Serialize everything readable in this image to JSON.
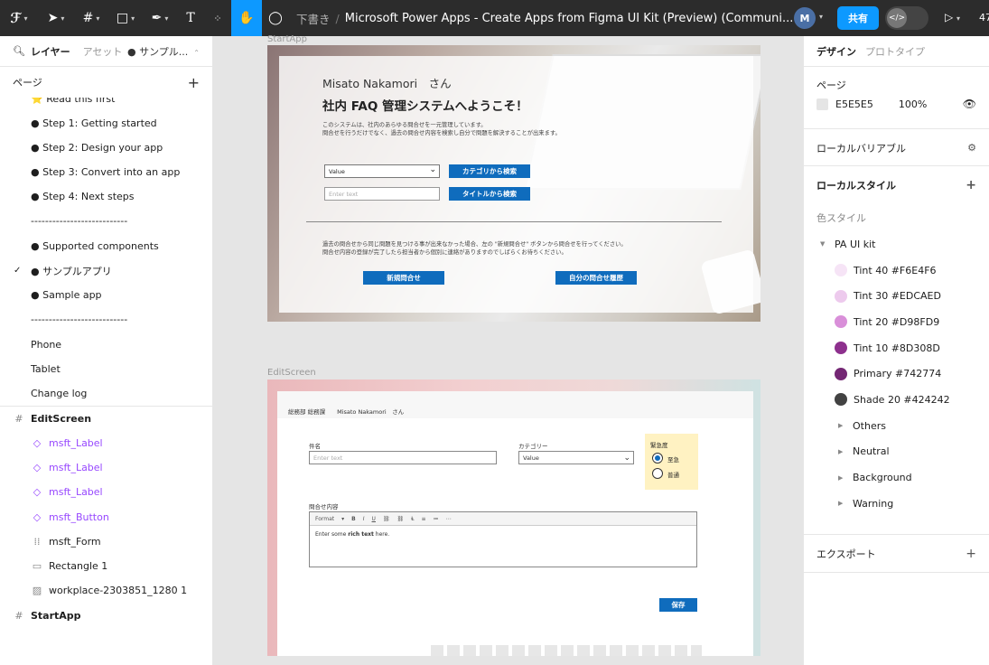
{
  "toolbar": {
    "breadcrumb_draft": "下書き",
    "breadcrumb_sep": "/",
    "file_title": "Microsoft Power Apps - Create Apps from Figma UI Kit (Preview) (Communi...",
    "avatar_initial": "M",
    "share_label": "共有",
    "dev_mode_label": "</>",
    "zoom_partial": "47"
  },
  "left_panel": {
    "tab_layers": "レイヤー",
    "tab_assets": "アセット",
    "current_page": "● サンプル...",
    "pages_header": "ページ",
    "pages": [
      {
        "label": "⭐ Read this first",
        "checked": false
      },
      {
        "label": "● Step 1: Getting started",
        "checked": false
      },
      {
        "label": "● Step 2: Design your app",
        "checked": false
      },
      {
        "label": "● Step 3: Convert into an app",
        "checked": false
      },
      {
        "label": "● Step 4: Next steps",
        "checked": false
      },
      {
        "label": "---------------------------",
        "checked": false
      },
      {
        "label": "● Supported components",
        "checked": false
      },
      {
        "label": "● サンプルアプリ",
        "checked": true
      },
      {
        "label": "● Sample app",
        "checked": false
      },
      {
        "label": "---------------------------",
        "checked": false
      },
      {
        "label": "Phone",
        "checked": false
      },
      {
        "label": "Tablet",
        "checked": false
      },
      {
        "label": "Change log",
        "checked": false
      }
    ],
    "layers": [
      {
        "label": "EditScreen",
        "kind": "frame",
        "icon": "#"
      },
      {
        "label": "msft_Label",
        "kind": "comp",
        "icon": "◇"
      },
      {
        "label": "msft_Label",
        "kind": "comp",
        "icon": "◇"
      },
      {
        "label": "msft_Label",
        "kind": "comp",
        "icon": "◇"
      },
      {
        "label": "msft_Button",
        "kind": "comp",
        "icon": "◇"
      },
      {
        "label": "msft_Form",
        "kind": "normal",
        "icon": "⁞⁞"
      },
      {
        "label": "Rectangle 1",
        "kind": "normal",
        "icon": "▭"
      },
      {
        "label": "workplace-2303851_1280 1",
        "kind": "normal",
        "icon": "▨"
      },
      {
        "label": "StartApp",
        "kind": "frame",
        "icon": "#"
      }
    ]
  },
  "right_panel": {
    "tab_design": "デザイン",
    "tab_prototype": "プロトタイプ",
    "page_section": "ページ",
    "page_color_hex": "E5E5E5",
    "page_color": "#e5e5e5",
    "page_opacity": "100%",
    "local_variables": "ローカルバリアブル",
    "local_styles": "ローカルスタイル",
    "color_styles": "色スタイル",
    "kit_group": "PA UI kit",
    "colors": [
      {
        "label": "Tint 40 #F6E4F6",
        "hex": "#F6E4F6"
      },
      {
        "label": "Tint 30 #EDCAED",
        "hex": "#EDCAED"
      },
      {
        "label": "Tint 20 #D98FD9",
        "hex": "#D98FD9"
      },
      {
        "label": "Tint 10 #8D308D",
        "hex": "#8D308D"
      },
      {
        "label": "Primary #742774",
        "hex": "#742774"
      },
      {
        "label": "Shade 20 #424242",
        "hex": "#424242"
      }
    ],
    "groups": [
      "Others",
      "Neutral",
      "Background",
      "Warning"
    ],
    "export": "エクスポート"
  },
  "canvas": {
    "start_label": "StartApp",
    "edit_label": "EditScreen",
    "start": {
      "user_name": "Misato Nakamori　さん",
      "welcome": "社内 FAQ 管理システムへようこそ！",
      "desc_line1": "このシステムは、社内のあらゆる問合せを一元管理しています。",
      "desc_line2": "問合せを行うだけでなく、過去の問合せ内容を検索し自分で問題を解決することが出来ます。",
      "select_value": "Value",
      "input_placeholder": "Enter text",
      "btn_category": "カテゴリから検索",
      "btn_title": "タイトルから検索",
      "note_line1": "過去の問合せから同じ問題を見つける事が出来なかった場合、左の \"新規問合せ\" ボタンから問合せを行ってください。",
      "note_line2": "問合せ内容の登録が完了したら担当者から個別に連絡がありますのでしばらくお待ちください。",
      "btn_new": "新規問合せ",
      "btn_history": "自分の問合せ履歴"
    },
    "edit": {
      "header": "総務部 総務課　　Misato Nakamori　さん",
      "subject_label": "件名",
      "subject_placeholder": "Enter text",
      "category_label": "カテゴリー",
      "category_value": "Value",
      "urgency_label": "緊急度",
      "urgency_opt1": "至急",
      "urgency_opt2": "普通",
      "content_label": "問合せ内容",
      "rte_format": "Format",
      "rte_body_pre": "Enter some ",
      "rte_body_bold": "rich text",
      "rte_body_post": " here.",
      "save": "保存"
    }
  }
}
